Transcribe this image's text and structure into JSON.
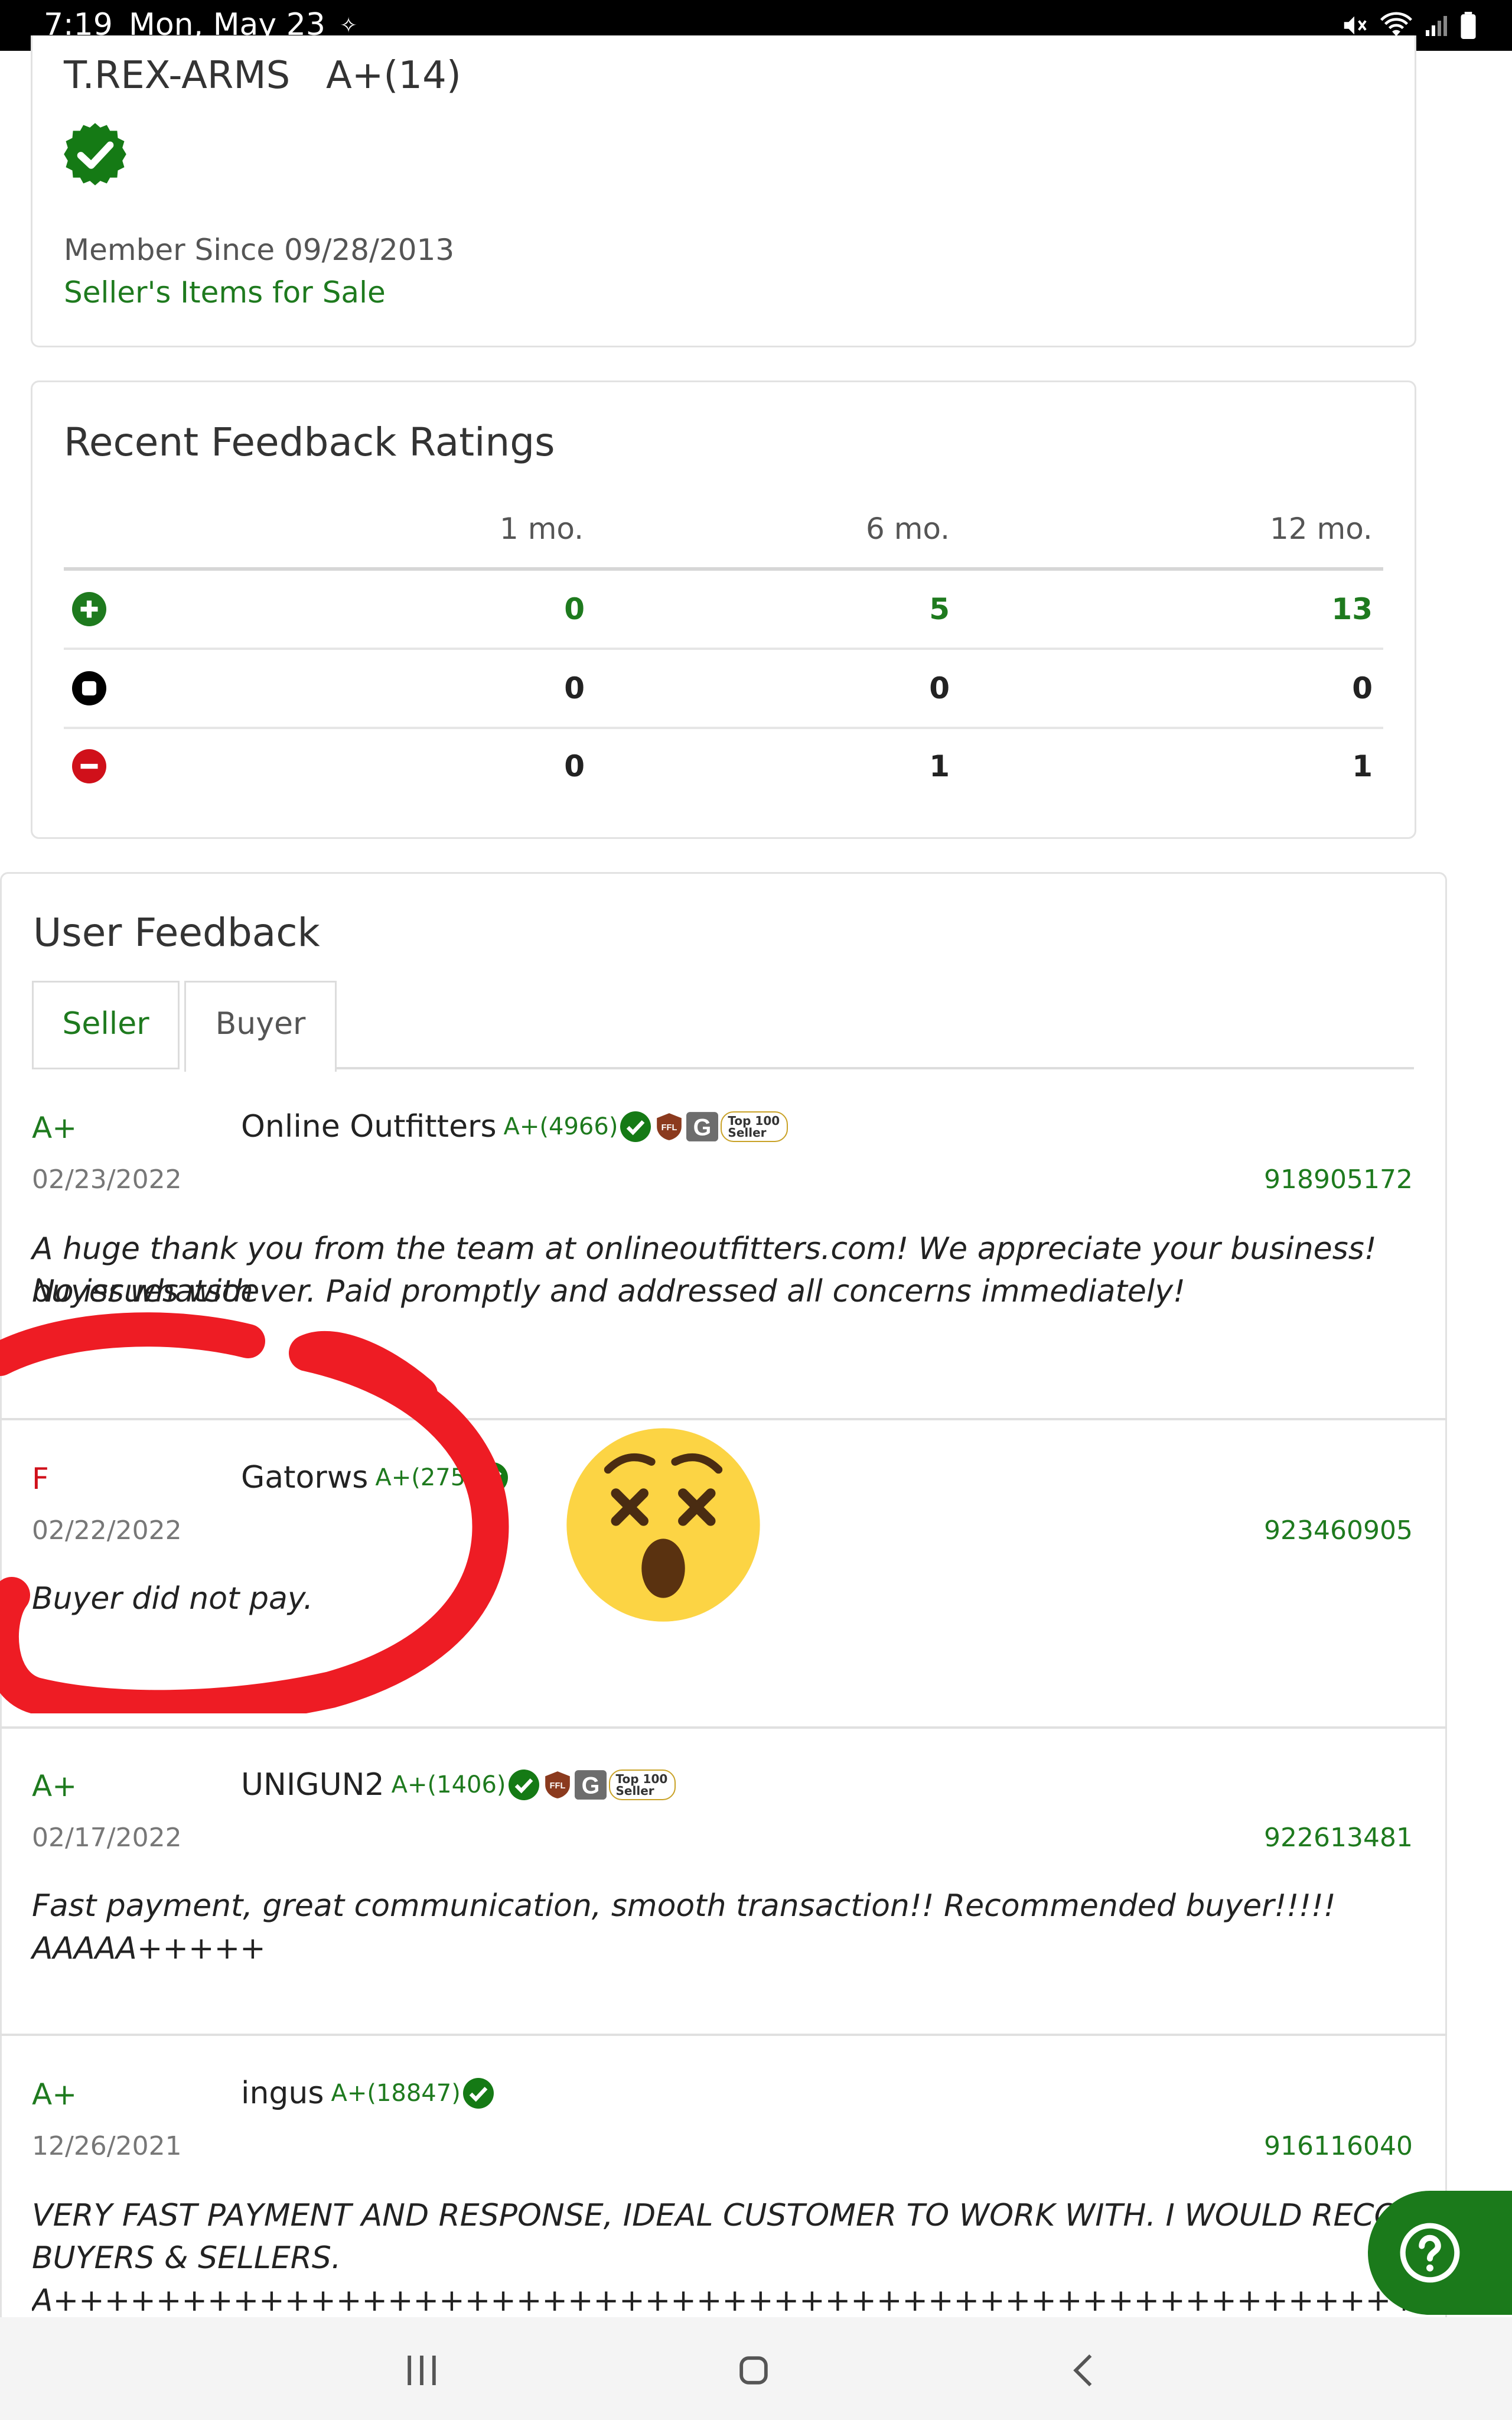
{
  "status_bar": {
    "time": "7:19",
    "date": "Mon, May 23",
    "dot": "✧"
  },
  "seller": {
    "name": "T.REX-ARMS",
    "rating": "A+(14)",
    "member_since": "Member Since 09/28/2013",
    "items_link": "Seller's Items for Sale"
  },
  "recent_feedback": {
    "title": "Recent Feedback Ratings",
    "columns": [
      "1 mo.",
      "6 mo.",
      "12 mo."
    ],
    "rows": [
      {
        "type": "positive",
        "icon": "plus-circle-icon",
        "values": [
          "0",
          "5",
          "13"
        ],
        "color": "#1e7a1e"
      },
      {
        "type": "neutral",
        "icon": "stop-circle-icon",
        "values": [
          "0",
          "0",
          "0"
        ],
        "color": "#000000"
      },
      {
        "type": "negative",
        "icon": "minus-circle-icon",
        "values": [
          "0",
          "1",
          "1"
        ],
        "color": "#d0101a"
      }
    ]
  },
  "user_feedback": {
    "title": "User Feedback",
    "tabs": [
      {
        "label": "Seller",
        "active": true
      },
      {
        "label": "Buyer",
        "active": false
      }
    ],
    "entries": [
      {
        "grade": "A+",
        "user": "Online Outfitters",
        "user_rating": "A+(4966)",
        "badges": [
          "verified-icon",
          "ffl-badge",
          "g-badge",
          "top100-seller-badge"
        ],
        "top_badge": "Top 100\nSeller",
        "date": "02/23/2022",
        "id": "918905172",
        "comment_line1": "A huge thank you from the team at onlineoutfitters.com! We appreciate your business! No issues with",
        "comment_line2": "buyer whatsoever. Paid promptly and addressed all concerns immediately!"
      },
      {
        "grade": "F",
        "user": "Gatorws",
        "user_rating": "A+(275)",
        "badges": [
          "verified-icon"
        ],
        "date": "02/22/2022",
        "id": "923460905",
        "comment_line1": "Buyer did not pay."
      },
      {
        "grade": "A+",
        "user": "UNIGUN2",
        "user_rating": "A+(1406)",
        "badges": [
          "verified-icon",
          "ffl-badge",
          "g-badge",
          "top100-seller-badge"
        ],
        "top_badge": "Top 100\nSeller",
        "date": "02/17/2022",
        "id": "922613481",
        "comment_line1": "Fast payment, great communication, smooth transaction!! Recommended buyer!!!!! AAAAA+++++"
      },
      {
        "grade": "A+",
        "user": "ingus",
        "user_rating": "A+(18847)",
        "badges": [
          "verified-icon"
        ],
        "date": "12/26/2021",
        "id": "916116040",
        "comment_line1": "VERY FAST PAYMENT AND RESPONSE, IDEAL CUSTOMER TO WORK WITH. I WOULD RECOMMEND TO A",
        "comment_line2": "BUYERS & SELLERS.",
        "comment_line3": "A++++++++++++++++++++++++++++++++++++++++++++++++++++++++++++++++++++++++++++++++++++THANK-"
      }
    ]
  },
  "colors": {
    "accent": "#1e7a1e",
    "fail": "#d0101a",
    "annotation": "#ee1c24",
    "emoji": "#fcd444"
  },
  "icons": {
    "help": "help-icon",
    "nav_recent": "recent-apps-icon",
    "nav_home": "home-icon",
    "nav_back": "back-icon",
    "emoji": "dizzy-face-emoji"
  }
}
